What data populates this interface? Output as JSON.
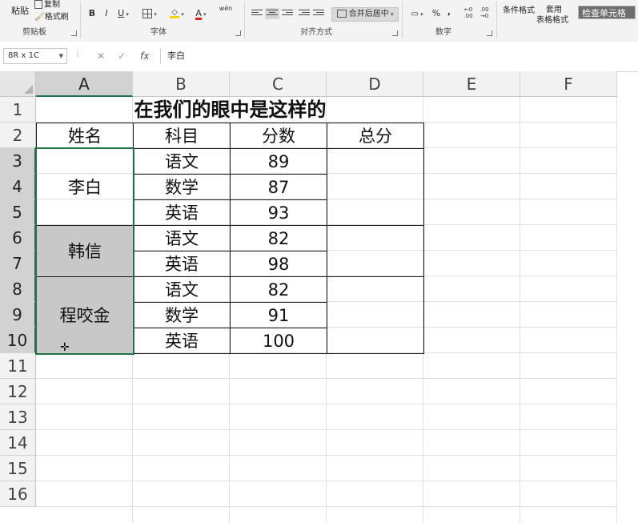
{
  "ribbon": {
    "clipboard": {
      "paste": "粘贴",
      "copy": "复制",
      "format_painter": "格式刷",
      "label": "剪贴板"
    },
    "font": {
      "bold": "B",
      "italic": "I",
      "underline": "U",
      "font_color": "A",
      "label": "字体"
    },
    "alignment": {
      "merge_center": "合并后居中",
      "label": "对齐方式"
    },
    "number": {
      "percent": "%",
      "comma": ",",
      "label": "数字"
    },
    "styles": {
      "conditional": "条件格式",
      "table_format_1": "套用",
      "table_format_2": "表格格式",
      "check_cell": "检查单元格"
    }
  },
  "formula_bar": {
    "name_box": "8R x 1C",
    "cancel": "✕",
    "enter": "✓",
    "fx": "fx",
    "content": "李白"
  },
  "grid": {
    "columns": [
      "A",
      "B",
      "C",
      "D",
      "E",
      "F"
    ],
    "rows": [
      "1",
      "2",
      "3",
      "4",
      "5",
      "6",
      "7",
      "8",
      "9",
      "10",
      "11",
      "12",
      "13",
      "14",
      "15",
      "16"
    ],
    "title": "在我们的眼中是这样的",
    "headers": [
      "姓名",
      "科目",
      "分数",
      "总分"
    ],
    "students": [
      {
        "name": "李白",
        "subjects": [
          "语文",
          "数学",
          "英语"
        ],
        "scores": [
          "89",
          "87",
          "93"
        ]
      },
      {
        "name": "韩信",
        "subjects": [
          "语文",
          "英语"
        ],
        "scores": [
          "82",
          "98"
        ]
      },
      {
        "name": "程咬金",
        "subjects": [
          "语文",
          "数学",
          "英语"
        ],
        "scores": [
          "82",
          "91",
          "100"
        ]
      }
    ]
  },
  "colors": {
    "selection": "#217346",
    "shade": "#c8c8c8"
  },
  "icons": [
    "copy-icon",
    "format-painter-icon",
    "borders-icon",
    "fill-color-icon",
    "align-left-icon",
    "align-center-icon",
    "align-right-icon",
    "indent-icon",
    "merge-icon",
    "currency-icon",
    "cross-cursor-icon"
  ]
}
